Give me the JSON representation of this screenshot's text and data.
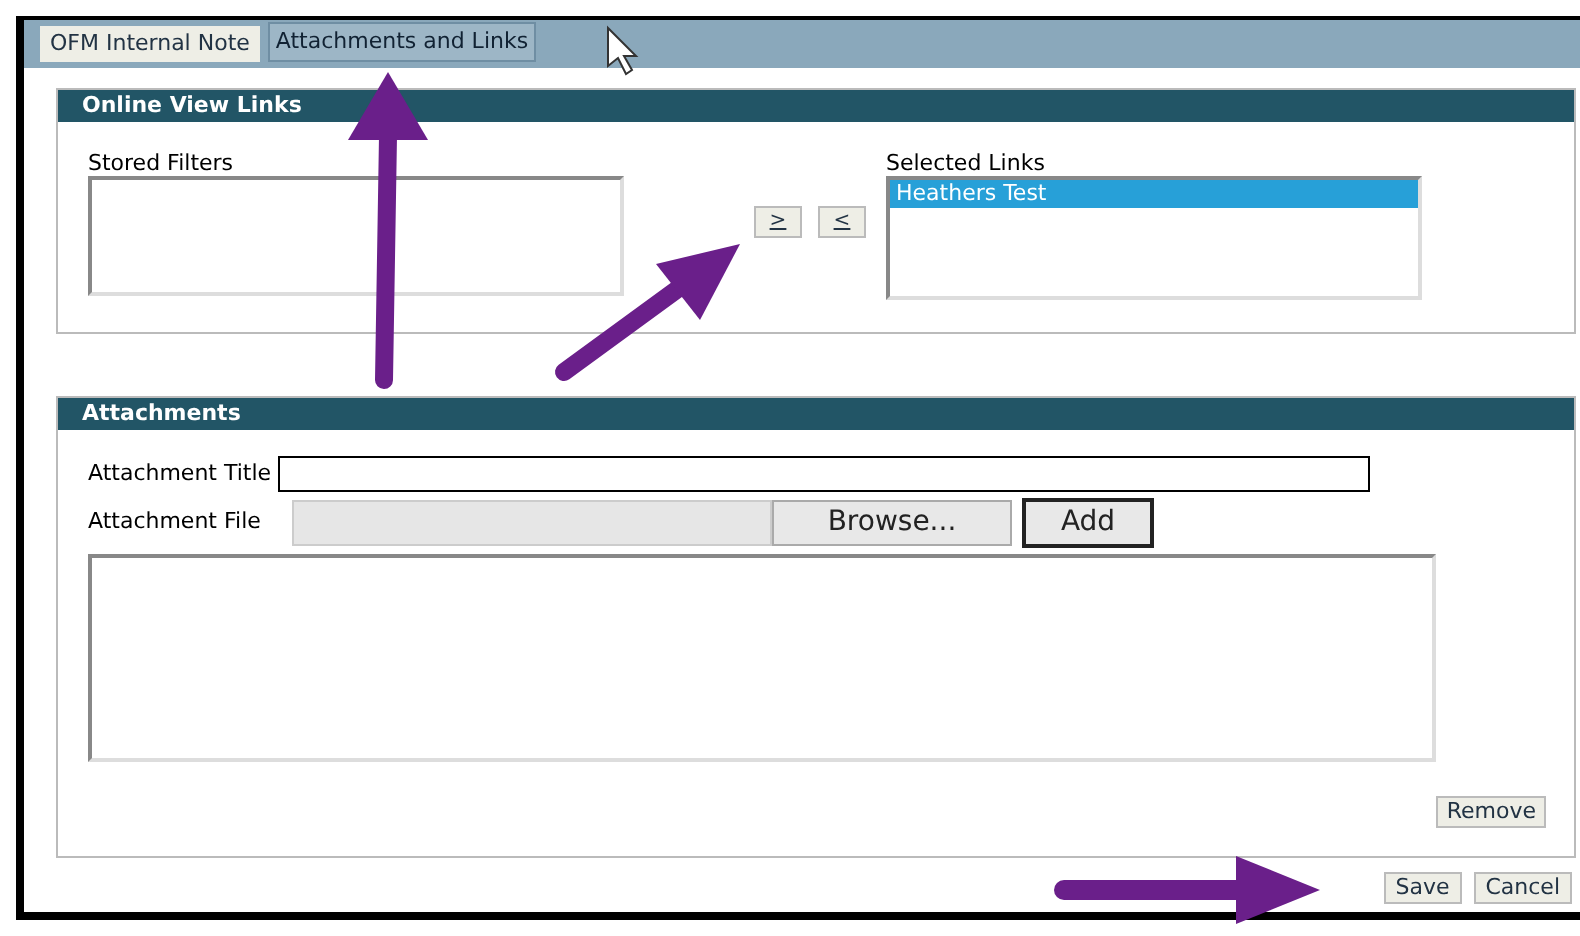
{
  "tabs": [
    {
      "label": "OFM Internal Note",
      "selected": false
    },
    {
      "label": "Attachments and Links",
      "selected": true
    }
  ],
  "online_view_links": {
    "title": "Online View Links",
    "stored_filters": {
      "label": "Stored Filters"
    },
    "move_buttons": [
      ">",
      "<"
    ],
    "selected_links": {
      "label": "Selected Links",
      "items": [
        {
          "label": "Heathers Test",
          "selected": true
        }
      ]
    }
  },
  "attachments": {
    "title": "Attachments",
    "title_field": {
      "label": "Attachment Title"
    },
    "file_field": {
      "label": "Attachment File",
      "browse": "Browse...",
      "add": "Add"
    },
    "remove": "Remove"
  },
  "buttons": [
    "Save",
    "Cancel"
  ]
}
